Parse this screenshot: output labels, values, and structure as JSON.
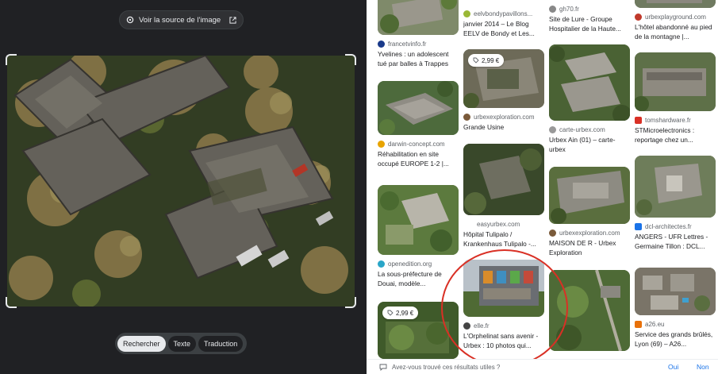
{
  "left": {
    "source_label": "Voir la source de l'image",
    "modes": [
      "Rechercher",
      "Texte",
      "Traduction"
    ],
    "active_mode": "Rechercher"
  },
  "results": {
    "col1": [
      {
        "source": "francetvinfo.fr",
        "title": "Yvelines : un adolescent tué par balles à Trappes",
        "fav_color": "#1a3a8a",
        "price": ""
      },
      {
        "source": "darwin-concept.com",
        "title": "Réhabilitation en site occupé EUROPE 1-2 |...",
        "fav_color": "#e8a400",
        "price": ""
      },
      {
        "source": "openedition.org",
        "title": "La sous-préfecture de Douai, modèle...",
        "fav_color": "#2aa6c8",
        "price": ""
      },
      {
        "source": "",
        "title": "",
        "fav_color": "",
        "price": "2,99 €"
      }
    ],
    "col2": [
      {
        "source": "eelvbondypavillons...",
        "title": "janvier 2014 – Le Blog EELV de Bondy et Les...",
        "fav_color": "#9ab836",
        "price": ""
      },
      {
        "source": "urbexexploration.com",
        "title": "Grande Usine",
        "fav_color": "#7a5a3a",
        "price": "2,99 €"
      },
      {
        "source": "easyurbex.com",
        "title": "Hôpital Tulipalo / Krankenhaus Tulipalo -...",
        "fav_color": "",
        "price": ""
      },
      {
        "source": "elle.fr",
        "title": "L'Orphelinat sans avenir - Urbex : 10 photos qui...",
        "fav_color": "#444444",
        "price": ""
      }
    ],
    "col3": [
      {
        "source": "gh70.fr",
        "title": "Site de Lure - Groupe Hospitalier de la Haute...",
        "fav_color": "#888888",
        "price": ""
      },
      {
        "source": "carte-urbex.com",
        "title": "Urbex Ain (01) – carte-urbex",
        "fav_color": "#999999",
        "price": ""
      },
      {
        "source": "urbexexploration.com",
        "title": "MAISON DE R - Urbex Exploration",
        "fav_color": "#7a5a3a",
        "price": ""
      },
      {
        "source": "",
        "title": "",
        "fav_color": "",
        "price": ""
      }
    ],
    "col4": [
      {
        "source": "urbexplayground.com",
        "title": "L'hôtel abandonné au pied de la montagne |...",
        "fav_color": "#c0392b",
        "price": ""
      },
      {
        "source": "tomshardware.fr",
        "title": "STMicroelectronics : reportage chez un...",
        "fav_color": "#d93025",
        "price": ""
      },
      {
        "source": "dcl-architectes.fr",
        "title": "ANGERS - UFR Lettres - Germaine Tillon : DCL...",
        "fav_color": "#1a73e8",
        "price": ""
      },
      {
        "source": "a26.eu",
        "title": "Service des grands brûlés, Lyon (69) – A26...",
        "fav_color": "#e8710a",
        "price": ""
      }
    ]
  },
  "feedback": {
    "question": "Avez-vous trouvé ces résultats utiles ?",
    "yes": "Oui",
    "no": "Non"
  },
  "colors": {
    "annotation_circle": "#d93025",
    "link": "#1a73e8"
  }
}
